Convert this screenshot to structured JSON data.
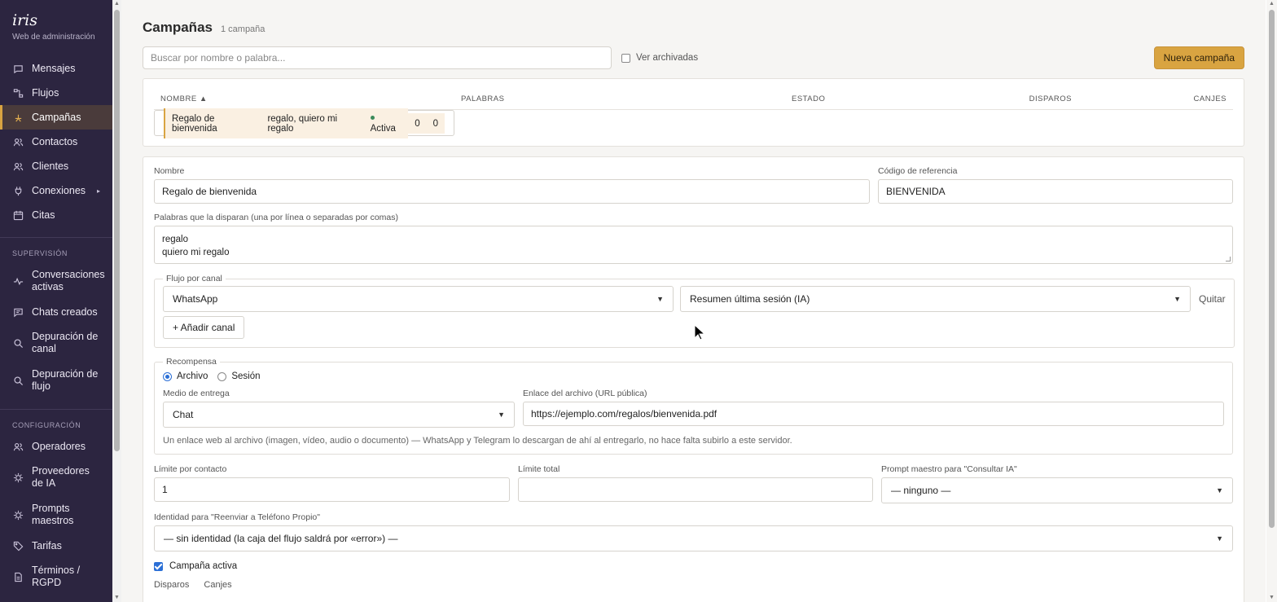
{
  "brand": {
    "logo": "iris",
    "subtitle": "Web de administración"
  },
  "sidebar": {
    "items": [
      {
        "id": "mensajes",
        "label": "Mensajes",
        "icon": "message-icon"
      },
      {
        "id": "flujos",
        "label": "Flujos",
        "icon": "flow-icon"
      },
      {
        "id": "campanas",
        "label": "Campañas",
        "icon": "campaign-icon",
        "active": true
      },
      {
        "id": "contactos",
        "label": "Contactos",
        "icon": "users-icon"
      },
      {
        "id": "clientes",
        "label": "Clientes",
        "icon": "users-icon"
      },
      {
        "id": "conexiones",
        "label": "Conexiones",
        "icon": "plug-icon",
        "chevron": "▸"
      },
      {
        "id": "citas",
        "label": "Citas",
        "icon": "calendar-icon"
      }
    ],
    "supervision_label": "SUPERVISIÓN",
    "supervision": [
      {
        "id": "conversaciones",
        "label": "Conversaciones activas",
        "icon": "pulse-icon"
      },
      {
        "id": "chats",
        "label": "Chats creados",
        "icon": "chat-icon"
      },
      {
        "id": "dep-canal",
        "label": "Depuración de canal",
        "icon": "search-icon"
      },
      {
        "id": "dep-flujo",
        "label": "Depuración de flujo",
        "icon": "search-icon"
      }
    ],
    "config_label": "CONFIGURACIÓN",
    "config": [
      {
        "id": "operadores",
        "label": "Operadores",
        "icon": "users-icon"
      },
      {
        "id": "proveedores",
        "label": "Proveedores de IA",
        "icon": "chip-icon"
      },
      {
        "id": "prompts",
        "label": "Prompts maestros",
        "icon": "chip-icon"
      },
      {
        "id": "tarifas",
        "label": "Tarifas",
        "icon": "tag-icon"
      },
      {
        "id": "terminos",
        "label": "Términos / RGPD",
        "icon": "document-icon"
      }
    ]
  },
  "header": {
    "title": "Campañas",
    "count": "1 campaña"
  },
  "toolbar": {
    "search_placeholder": "Buscar por nombre o palabra...",
    "archived_label": "Ver archivadas",
    "new_button": "Nueva campaña"
  },
  "table": {
    "columns": {
      "name": "NOMBRE ▲",
      "words": "PALABRAS",
      "status": "ESTADO",
      "shots": "DISPAROS",
      "redeems": "CANJES"
    },
    "rows": [
      {
        "name": "Regalo de bienvenida",
        "words": "regalo, quiero mi regalo",
        "status": "Activa",
        "shots": "0",
        "redeems": "0"
      }
    ]
  },
  "form": {
    "name_label": "Nombre",
    "name_value": "Regalo de bienvenida",
    "ref_label": "Código de referencia",
    "ref_value": "BIENVENIDA",
    "words_label": "Palabras que la disparan (una por línea o separadas por comas)",
    "words_value": "regalo\nquiero mi regalo",
    "channel_legend": "Flujo por canal",
    "channel_value": "WhatsApp",
    "flow_value": "Resumen última sesión (IA)",
    "remove_label": "Quitar",
    "add_channel": "+ Añadir canal",
    "reward_legend": "Recompensa",
    "reward_file": "Archivo",
    "reward_session": "Sesión",
    "delivery_label": "Medio de entrega",
    "delivery_value": "Chat",
    "file_url_label": "Enlace del archivo (URL pública)",
    "file_url_value": "https://ejemplo.com/regalos/bienvenida.pdf",
    "reward_help": "Un enlace web al archivo (imagen, vídeo, audio o documento) — WhatsApp y Telegram lo descargan de ahí al entregarlo, no hace falta subirlo a este servidor.",
    "limit_contact_label": "Límite por contacto",
    "limit_contact_value": "1",
    "limit_total_label": "Límite total",
    "limit_total_value": "",
    "prompt_label": "Prompt maestro para \"Consultar IA\"",
    "prompt_value": "— ninguno —",
    "identity_label": "Identidad para \"Reenviar a Teléfono Propio\"",
    "identity_value": "— sin identidad (la caja del flujo saldrá por «error») —",
    "active_label": "Campaña activa",
    "tab_shots": "Disparos",
    "tab_redeems": "Canjes"
  }
}
